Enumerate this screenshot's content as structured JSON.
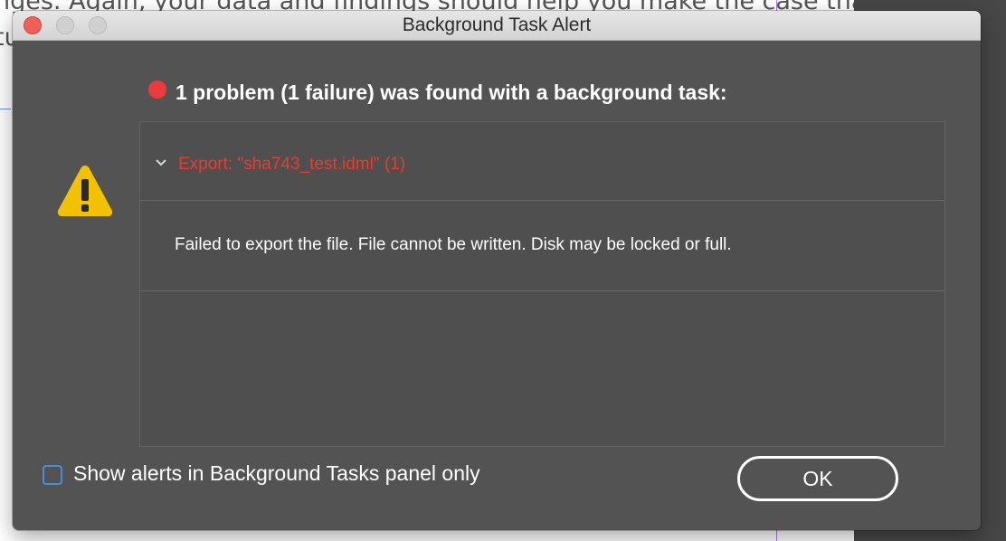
{
  "background_document": {
    "text_line": "nges. Again, your data and findings should help you make the case that",
    "text_line_2": "tu"
  },
  "dialog": {
    "title": "Background Task Alert",
    "headline": "1 problem (1 failure) was found with a background task:",
    "status_color": "#ec3b3b",
    "icons": {
      "status": "error-dot-icon",
      "warning": "warning-triangle-icon",
      "expand": "chevron-down-icon"
    },
    "tasks": [
      {
        "title": "Export: \"sha743_test.idml\" (1)",
        "title_color": "#ea3b2b",
        "expanded": true,
        "message": "Failed to export the file. File cannot be written. Disk may be locked or full."
      }
    ],
    "checkbox": {
      "label": "Show alerts in Background Tasks panel only",
      "checked": false
    },
    "ok_label": "OK"
  }
}
